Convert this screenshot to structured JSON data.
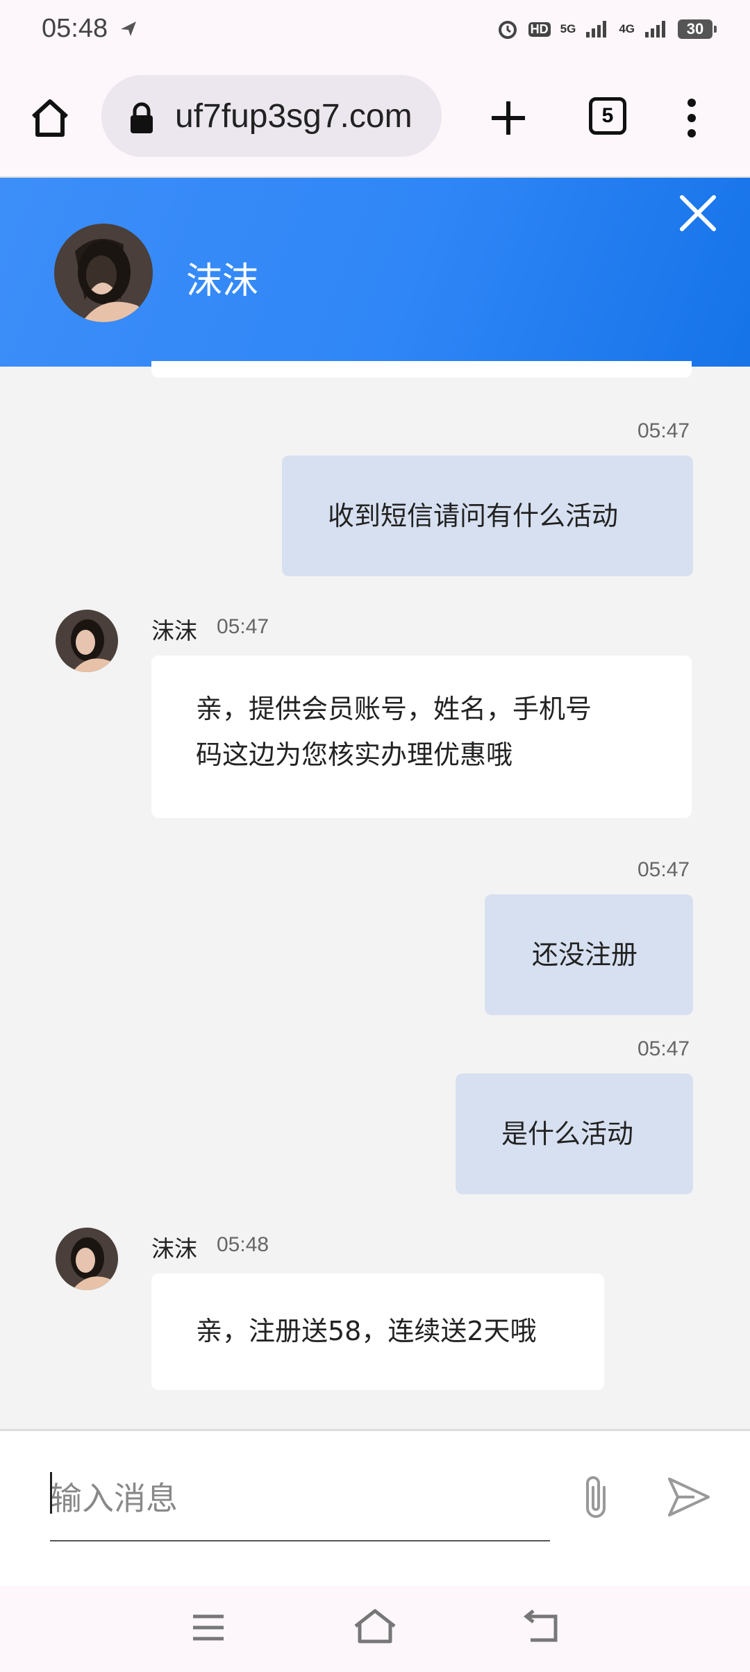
{
  "status_bar": {
    "time": "05:48",
    "network_1": "5G",
    "network_2": "4G",
    "battery": "30"
  },
  "browser": {
    "url": "uf7fup3sg7.com",
    "tab_count": "5"
  },
  "chat": {
    "agent_name": "沫沫",
    "input_placeholder": "输入消息",
    "messages": [
      {
        "from": "me",
        "time": "05:47",
        "text": "收到短信请问有什么活动"
      },
      {
        "from": "agent",
        "name": "沫沫",
        "time": "05:47",
        "lines": [
          "亲，提供会员账号，姓名，手机号",
          "码这边为您核实办理优惠哦"
        ]
      },
      {
        "from": "me",
        "time": "05:47",
        "text": "还没注册"
      },
      {
        "from": "me",
        "time": "05:47",
        "text": "是什么活动"
      },
      {
        "from": "agent",
        "name": "沫沫",
        "time": "05:48",
        "lines": [
          "亲，注册送58，连续送2天哦"
        ]
      }
    ]
  },
  "colors": {
    "header_blue": "#2f86f6",
    "my_bubble": "#d7e0f0",
    "agent_bubble": "#ffffff",
    "chat_background": "#f3f3f3"
  },
  "icons": {
    "home": "home-icon",
    "lock": "lock-icon",
    "new_tab": "plus-icon",
    "menu": "more-vert-icon",
    "close": "close-icon",
    "attach": "paperclip-icon",
    "send": "send-icon"
  }
}
